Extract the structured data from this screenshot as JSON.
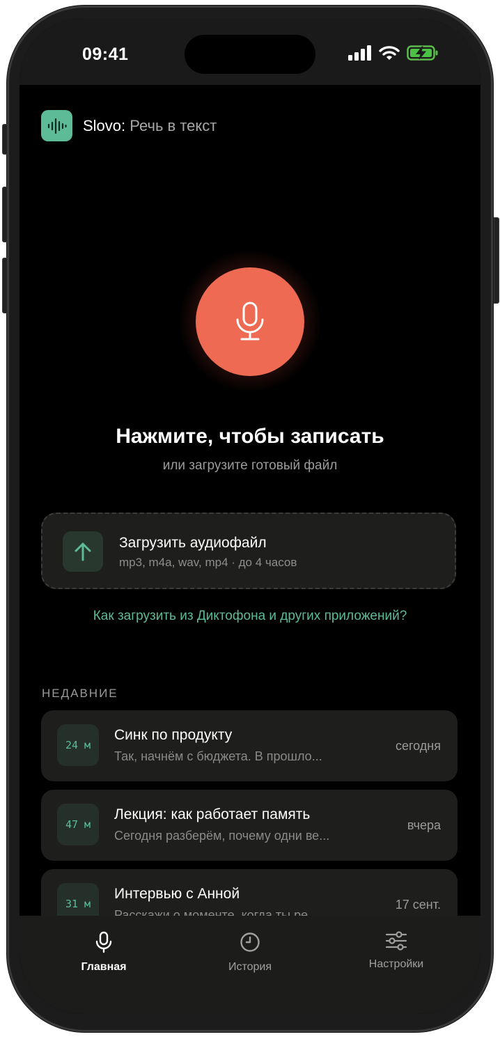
{
  "status_bar": {
    "time": "09:41"
  },
  "app": {
    "name": "Slovo",
    "name_separator": ":",
    "subtitle": "Речь в текст"
  },
  "record": {
    "mic_icon": "microphone-icon",
    "headline": "Нажмите, чтобы записать",
    "subline": "или загрузите готовый файл"
  },
  "upload": {
    "icon": "arrow-up-icon",
    "title": "Загрузить аудиофайл",
    "subtitle": "mp3, m4a, wav, mp4 · до 4 часов"
  },
  "help_link": "Как загрузить из Диктофона и других приложений?",
  "recent": {
    "section_title": "НЕДАВНИЕ",
    "items": [
      {
        "duration": "24 м",
        "title": "Синк по продукту",
        "snippet": "Так, начнём с бюджета. В прошло...",
        "date": "сегодня"
      },
      {
        "duration": "47 м",
        "title": "Лекция: как работает память",
        "snippet": "Сегодня разберём, почему одни ве...",
        "date": "вчера"
      },
      {
        "duration": "31 м",
        "title": "Интервью с Анной",
        "snippet": "Расскажи о моменте, когда ты ре...",
        "date": "17 сент."
      }
    ]
  },
  "tabs": [
    {
      "label": "Главная",
      "icon": "microphone-icon",
      "active": true
    },
    {
      "label": "История",
      "icon": "clock-icon",
      "active": false
    },
    {
      "label": "Настройки",
      "icon": "sliders-icon",
      "active": false
    }
  ],
  "colors": {
    "accent": "#5dbb98",
    "record": "#ef6a52",
    "background": "#000000",
    "card": "#1e1e1c"
  }
}
